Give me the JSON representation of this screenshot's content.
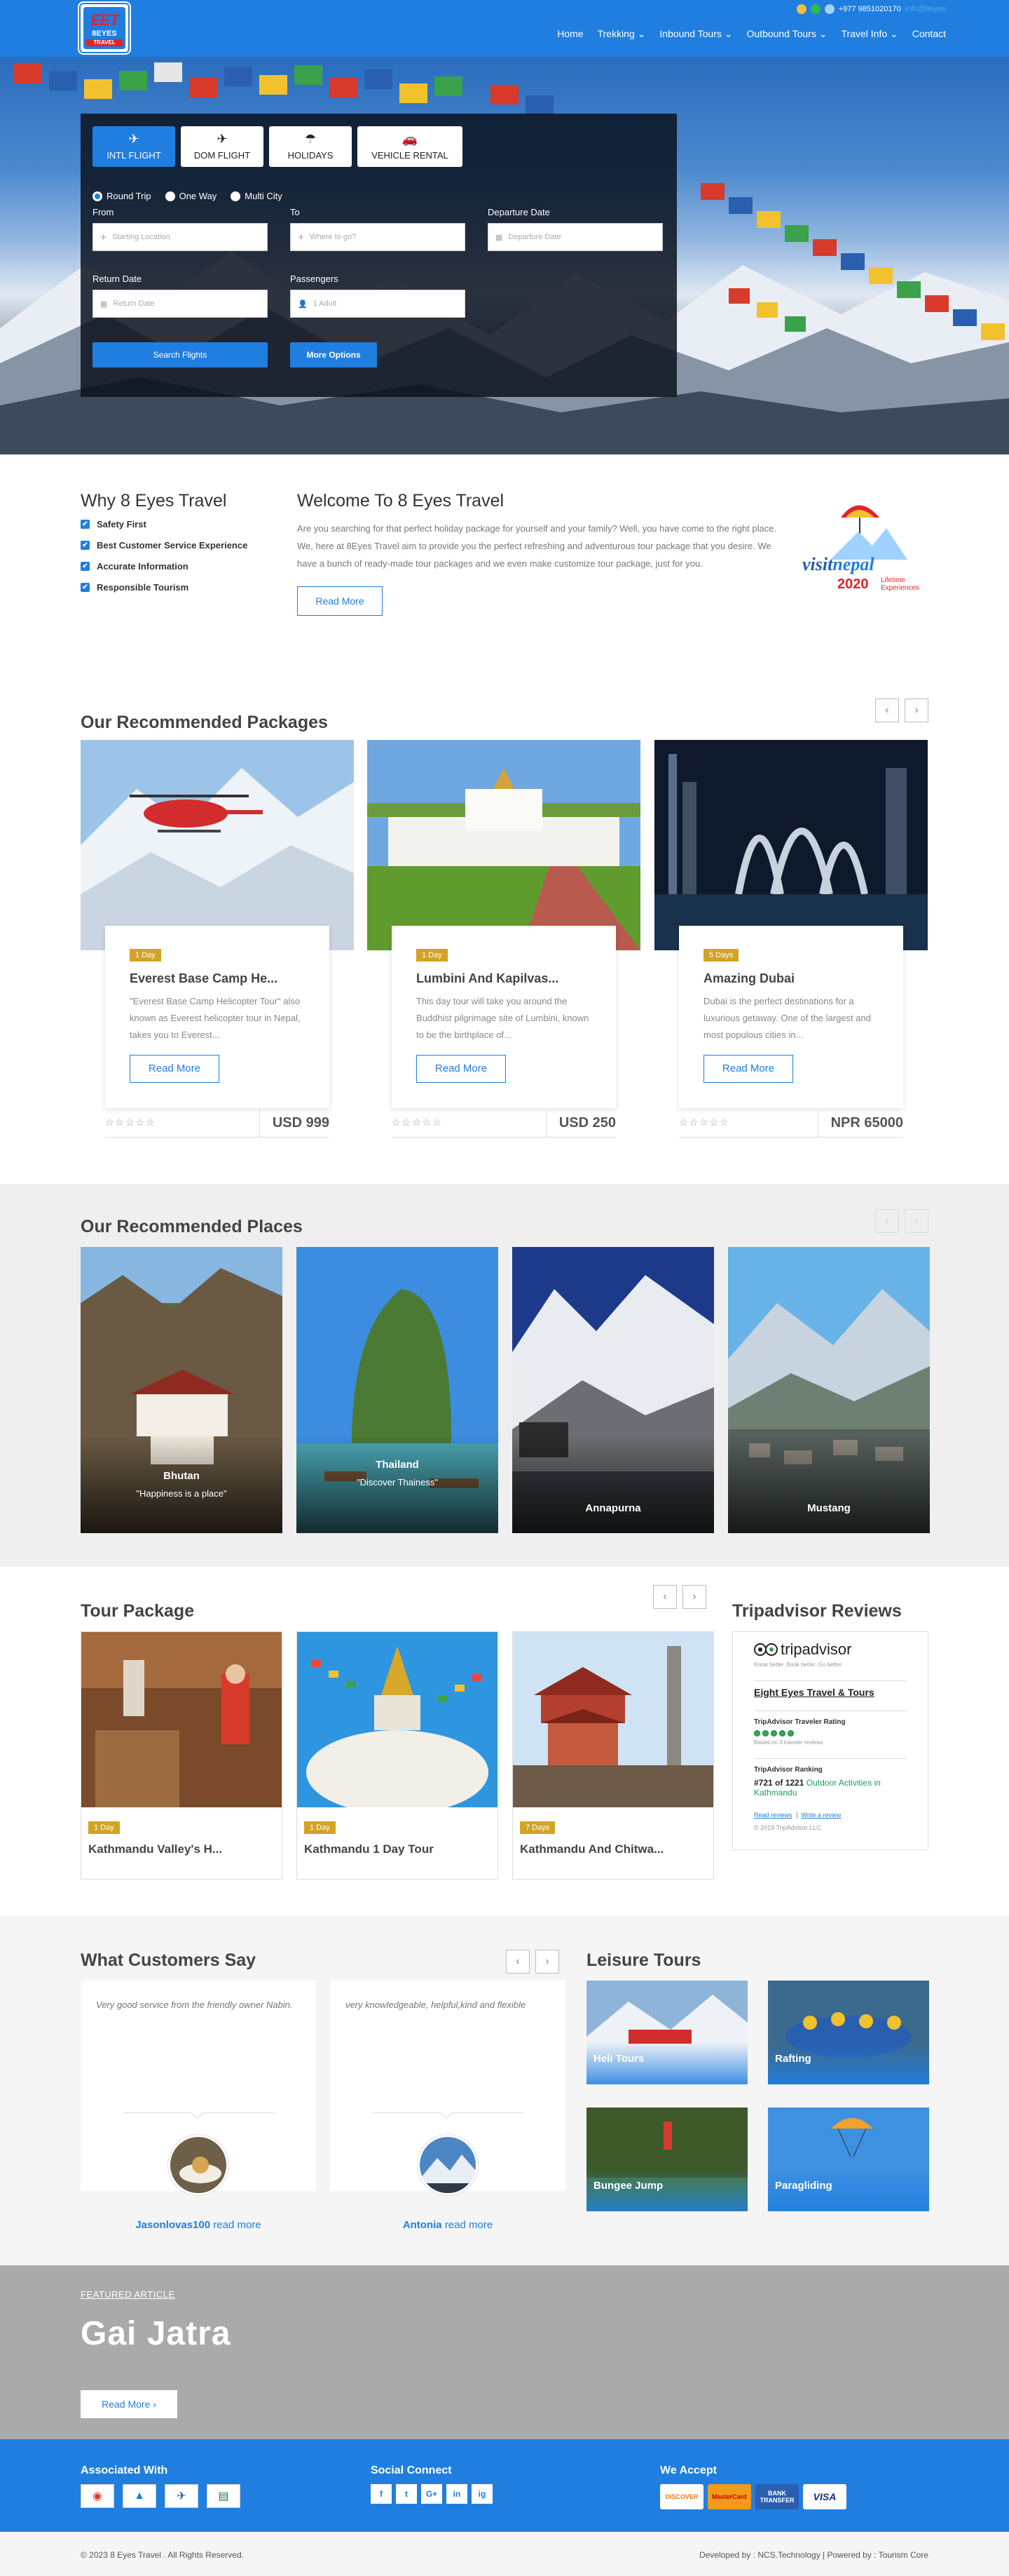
{
  "header": {
    "logo": {
      "big": "EET",
      "mid": "8EYES",
      "small": "TRAVEL"
    },
    "phone": "+977 9851020170",
    "email": "info@8eyes",
    "nav": [
      "Home",
      "Trekking",
      "Inbound Tours",
      "Outbound Tours",
      "Travel Info",
      "Contact"
    ]
  },
  "search": {
    "tabs": [
      "INTL FLIGHT",
      "DOM FLIGHT",
      "HOLIDAYS",
      "VEHICLE RENTAL"
    ],
    "trip_types": [
      "Round Trip",
      "One Way",
      "Multi City"
    ],
    "from_label": "From",
    "from_placeholder": "Starting Location",
    "to_label": "To",
    "to_placeholder": "Where to go?",
    "departure_label": "Departure Date",
    "departure_placeholder": "Departure Date",
    "return_label": "Return Date",
    "return_placeholder": "Return Date",
    "passengers_label": "Passengers",
    "passengers_value": "1 Adult",
    "search_btn": "Search Flights",
    "more_btn": "More Options"
  },
  "why": {
    "title": "Why 8 Eyes Travel",
    "items": [
      "Safety First",
      "Best Customer Service Experience",
      "Accurate Information",
      "Responsible Tourism"
    ]
  },
  "welcome": {
    "title": "Welcome To 8 Eyes Travel",
    "text": "Are you searching for that perfect holiday package for yourself and your family? Well, you have come to the right place. We, here at 8Eyes Travel aim to provide you the perfect refreshing and adventurous tour package that you desire. We have a bunch of ready-made tour packages and we even make customize tour package, just for you.",
    "read_more": "Read More",
    "badge": {
      "visit": "visit",
      "nepal": "nepal",
      "year": "2020",
      "tag1": "Lifetime",
      "tag2": "Experiences"
    }
  },
  "packages": {
    "title": "Our Recommended Packages",
    "items": [
      {
        "days": "1 Day",
        "title": "Everest Base Camp He...",
        "text": "\"Everest Base Camp Helicopter Tour\" also known as Everest helicopter tour in Nepal, takes you to Everest...",
        "price": "USD 999",
        "btn": "Read More"
      },
      {
        "days": "1 Day",
        "title": "Lumbini And Kapilvas...",
        "text": "This day tour will take you around the Buddhist pilgrimage site of Lumbini, known to be the birthplace of...",
        "price": "USD 250",
        "btn": "Read More"
      },
      {
        "days": "5 Days",
        "title": "Amazing Dubai",
        "text": "Dubai is the perfect destinations for a luxurious getaway. One of the largest and most populous cities in...",
        "price": "NPR 65000",
        "btn": "Read More"
      }
    ]
  },
  "places": {
    "title": "Our Recommended Places",
    "items": [
      {
        "name": "Bhutan",
        "desc": "\"Happiness is a place\""
      },
      {
        "name": "Thailand",
        "desc": "\"Discover Thainess\""
      },
      {
        "name": "Annapurna",
        "desc": ""
      },
      {
        "name": "Mustang",
        "desc": ""
      }
    ]
  },
  "tours": {
    "title": "Tour Package",
    "items": [
      {
        "days": "1 Day",
        "title": "Kathmandu Valley's H..."
      },
      {
        "days": "1 Day",
        "title": "Kathmandu 1 Day Tour"
      },
      {
        "days": "7 Days",
        "title": "Kathmandu And Chitwa..."
      }
    ]
  },
  "tripadvisor": {
    "title": "Tripadvisor Reviews",
    "brand": "tripadvisor",
    "tagline": "Know better. Book better. Go better.",
    "business": "Eight Eyes Travel & Tours",
    "rating_label": "TripAdvisor Traveler Rating",
    "reviews": "Based on 3 traveler reviews",
    "ranking_label": "TripAdvisor Ranking",
    "rank": "#721 of 1221",
    "rank_category": "Outdoor Activities in Kathmandu",
    "read_reviews": "Read reviews",
    "write_review": "Write a review",
    "copyright": "© 2019 TripAdvisor LLC"
  },
  "customers": {
    "title": "What Customers Say",
    "items": [
      {
        "text": "Very good service from the friendly owner Nabin.",
        "name": "Jasonlovas100",
        "more": "read more"
      },
      {
        "text": "very knowledgeable, helpful,kind and flexible",
        "name": "Antonia",
        "more": "read more"
      }
    ]
  },
  "leisure": {
    "title": "Leisure Tours",
    "items": [
      "Heli Tours",
      "Rafting",
      "Bungee Jump",
      "Paragliding"
    ]
  },
  "featured": {
    "label": "FEATURED ARTICLE",
    "title": "Gai Jatra",
    "btn": "Read More ›"
  },
  "footer": {
    "associated": "Associated With",
    "social": "Social Connect",
    "social_icons": [
      "f",
      "t",
      "G+",
      "in",
      "ig"
    ],
    "accept": "We Accept",
    "cards": [
      "DISCOVER",
      "MasterCard",
      "BANK TRANSFER",
      "VISA"
    ],
    "copyright": "© 2023 8 Eyes Travel . All Rights Reserved.",
    "developed": "Developed by : NCS.Technology | Powered by : Tourism Core"
  }
}
